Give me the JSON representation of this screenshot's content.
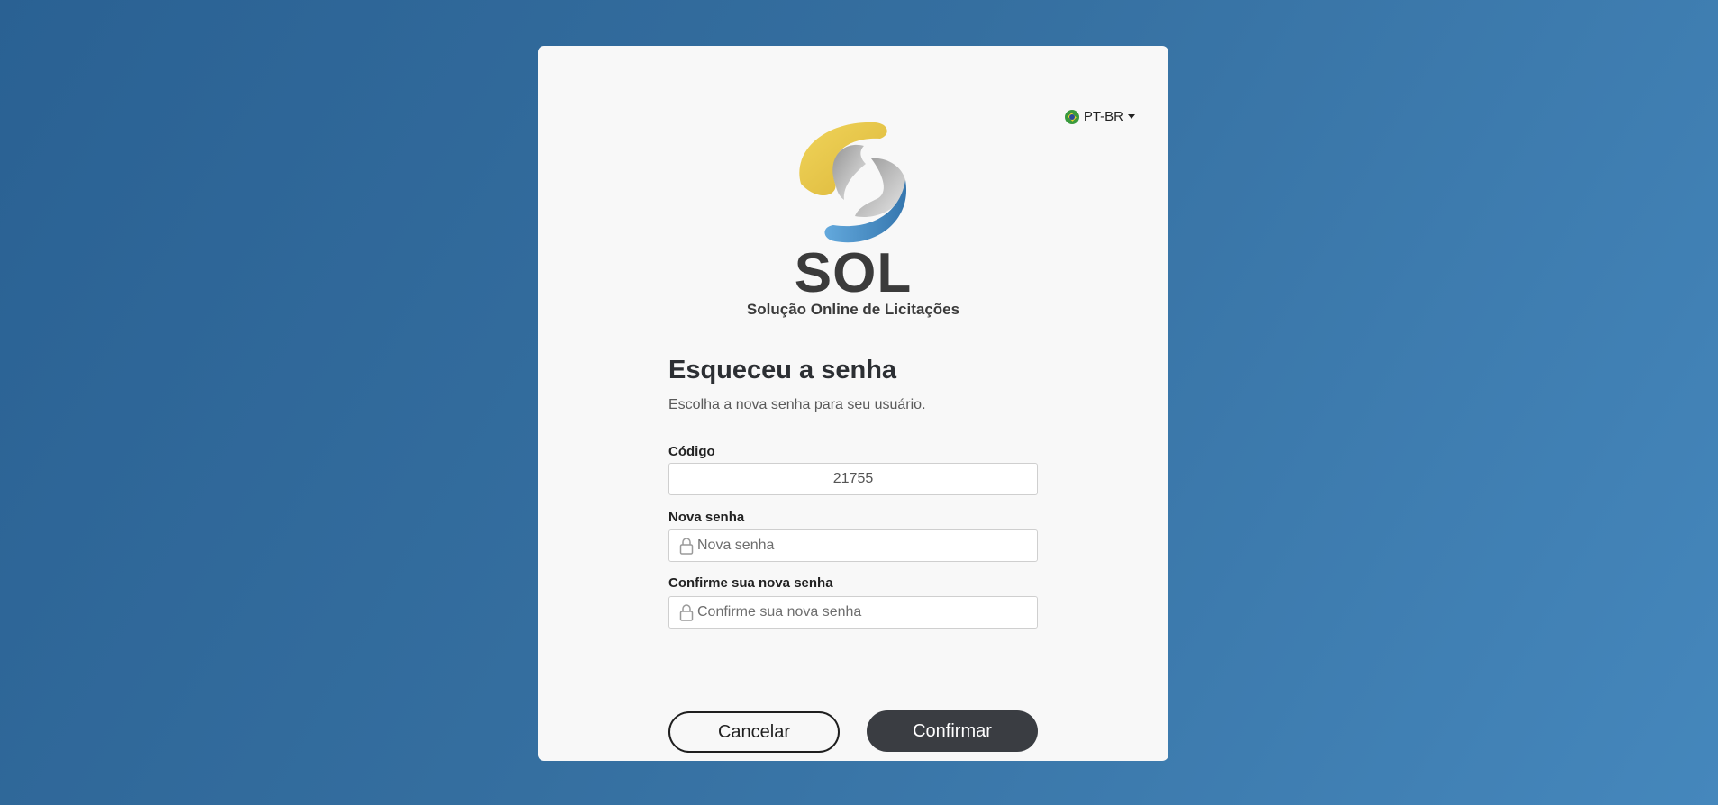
{
  "language": {
    "label": "PT-BR",
    "flag_icon": "brazil-flag-icon"
  },
  "brand": {
    "name": "SOL",
    "tagline": "Solução Online de Licitações"
  },
  "form": {
    "title": "Esqueceu a senha",
    "subtitle": "Escolha a nova senha para seu usuário.",
    "code": {
      "label": "Código",
      "value": "21755"
    },
    "new_password": {
      "label": "Nova senha",
      "placeholder": "Nova senha",
      "icon": "lock-icon"
    },
    "confirm_password": {
      "label": "Confirme sua nova senha",
      "placeholder": "Confirme sua nova senha",
      "icon": "lock-icon"
    },
    "cancel_label": "Cancelar",
    "confirm_label": "Confirmar"
  },
  "colors": {
    "background_start": "#2a6193",
    "background_end": "#4587bc",
    "card": "#f8f8f8",
    "primary_button": "#3a3d42",
    "logo_yellow": "#e9c84a",
    "logo_blue": "#4a8cc4",
    "logo_gray": "#a9a9a9"
  }
}
